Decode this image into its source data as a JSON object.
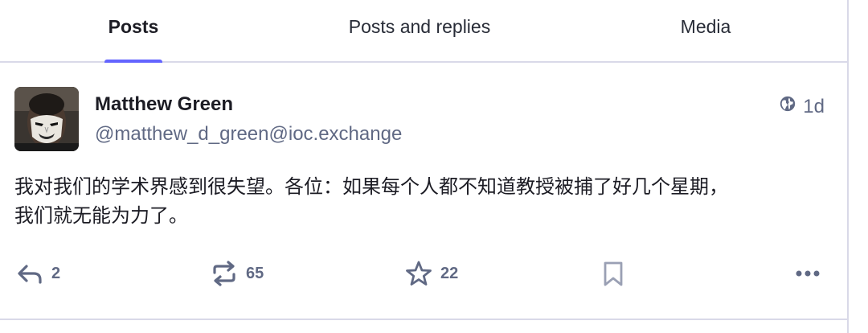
{
  "tabs": [
    {
      "label": "Posts",
      "active": true
    },
    {
      "label": "Posts and replies",
      "active": false
    },
    {
      "label": "Media",
      "active": false
    }
  ],
  "post": {
    "author_name": "Matthew Green",
    "author_handle": "@matthew_d_green@ioc.exchange",
    "visibility_icon": "globe-icon",
    "age": "1d",
    "content": [
      "我对我们的学术界感到很失望。各位：如果每个人都不知道教授被捕了好几个星期，",
      "我们就无能为力了。"
    ],
    "counts": {
      "replies": "2",
      "boosts": "65",
      "favourites": "22"
    }
  },
  "colors": {
    "accent": "#6364ff",
    "text_primary": "#1c1c24",
    "text_secondary": "#606984",
    "divider": "#d9d9e8"
  }
}
